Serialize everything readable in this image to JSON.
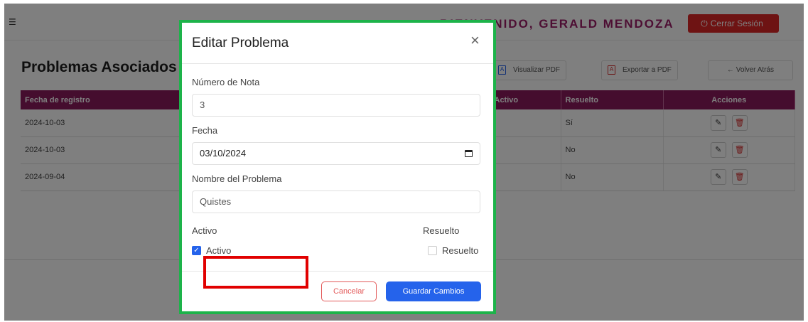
{
  "header": {
    "menu_icon": "menu-icon",
    "welcome": "BIENVENIDO, GERALD MENDOZA",
    "logout_label": "Cerrar Sesión",
    "logout_icon": "logout-icon"
  },
  "page": {
    "title": "Problemas Asociados"
  },
  "toolbar": {
    "view_pdf": "Visualizar PDF",
    "export_pdf": "Exportar a PDF",
    "back": "← Volver Atrás"
  },
  "table": {
    "columns": [
      "Fecha de registro",
      "Activo",
      "Resuelto",
      "Acciones"
    ],
    "rows": [
      {
        "fecha": "2024-10-03",
        "resuelto": "Sí"
      },
      {
        "fecha": "2024-10-03",
        "resuelto": "No"
      },
      {
        "fecha": "2024-09-04",
        "resuelto": "No"
      }
    ]
  },
  "modal": {
    "title": "Editar Problema",
    "nota_label": "Número de Nota",
    "nota_value": "3",
    "fecha_label": "Fecha",
    "fecha_value": "03/10/2024",
    "nombre_label": "Nombre del Problema",
    "nombre_value": "Quistes",
    "activo_heading": "Activo",
    "activo_checkbox": "Activo",
    "activo_checked": true,
    "resuelto_heading": "Resuelto",
    "resuelto_checkbox": "Resuelto",
    "resuelto_checked": false,
    "cancel": "Cancelar",
    "save": "Guardar Cambios"
  },
  "colors": {
    "brand": "#8b1a5c",
    "primary": "#2563eb",
    "danger": "#dc2626",
    "highlight_modal": "#1db34a",
    "highlight_button": "#e10000"
  }
}
